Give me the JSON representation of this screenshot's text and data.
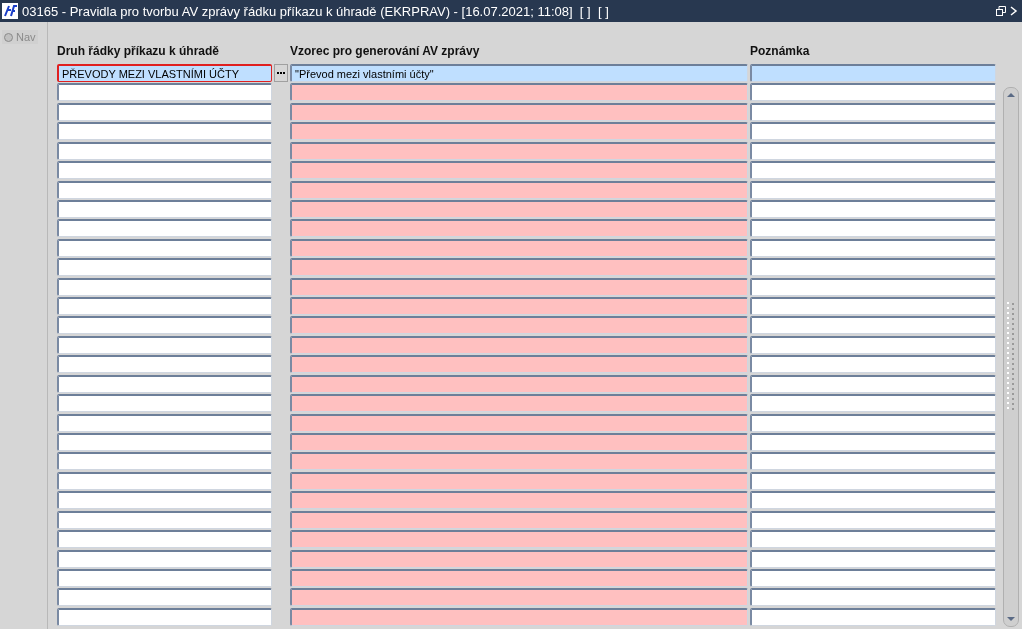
{
  "window": {
    "title": "03165 - Pravidla pro tvorbu AV zprávy řádku příkazu k úhradě (EKRPRAV) - [16.07.2021; 11:08]  [ ]  [ ]"
  },
  "nav": {
    "label": "Nav",
    "checked": false
  },
  "table": {
    "columns": [
      "Druh řádky příkazu k úhradě",
      "Vzorec pro generování AV zprávy",
      "Poznámka"
    ],
    "rows": [
      {
        "druh": "PŘEVODY MEZI VLASTNÍMI ÚČTY",
        "vzorec": "\"Převod mezi vlastními účty\"",
        "selected": true
      },
      {
        "selected": false
      },
      {
        "selected": false
      },
      {
        "selected": false
      },
      {
        "selected": false
      },
      {
        "selected": false
      },
      {
        "selected": false
      },
      {
        "selected": false
      },
      {
        "selected": false
      },
      {
        "selected": false
      },
      {
        "selected": false
      },
      {
        "selected": false
      },
      {
        "selected": false
      },
      {
        "selected": false
      },
      {
        "selected": false
      },
      {
        "selected": false
      },
      {
        "selected": false
      },
      {
        "selected": false
      },
      {
        "selected": false
      },
      {
        "selected": false
      },
      {
        "selected": false
      },
      {
        "selected": false
      },
      {
        "selected": false
      },
      {
        "selected": false
      },
      {
        "selected": false
      },
      {
        "selected": false
      },
      {
        "selected": false
      },
      {
        "selected": false
      },
      {
        "selected": false
      }
    ]
  }
}
